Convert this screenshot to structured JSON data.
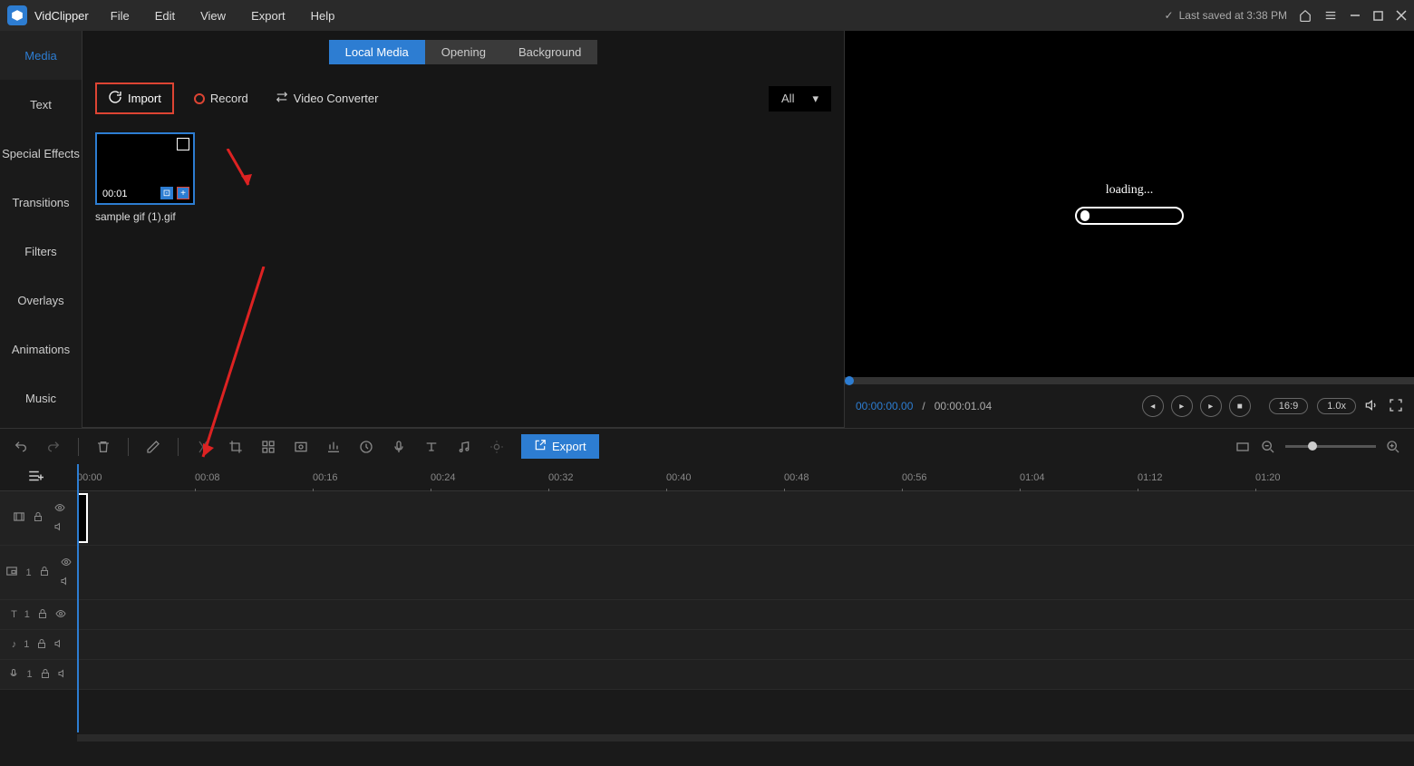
{
  "titlebar": {
    "app_name": "VidClipper",
    "menus": [
      "File",
      "Edit",
      "View",
      "Export",
      "Help"
    ],
    "save_status": "Last saved at 3:38 PM"
  },
  "side_tabs": [
    "Media",
    "Text",
    "Special Effects",
    "Transitions",
    "Filters",
    "Overlays",
    "Animations",
    "Music"
  ],
  "media_tabs": [
    "Local Media",
    "Opening",
    "Background"
  ],
  "media_toolbar": {
    "import": "Import",
    "record": "Record",
    "converter": "Video Converter",
    "filter": "All"
  },
  "media_thumb": {
    "duration": "00:01",
    "name": "sample gif (1).gif"
  },
  "preview": {
    "loading": "loading...",
    "current": "00:00:00.00",
    "sep": "/",
    "duration": "00:00:01.04",
    "aspect": "16:9",
    "speed": "1.0x"
  },
  "timeline_toolbar": {
    "export": "Export"
  },
  "ruler": [
    "00:00",
    "00:08",
    "00:16",
    "00:24",
    "00:32",
    "00:40",
    "00:48",
    "00:56",
    "01:04",
    "01:12",
    "01:20"
  ],
  "track_labels": {
    "pip": "1",
    "text": "1",
    "audio": "1",
    "mic": "1"
  }
}
